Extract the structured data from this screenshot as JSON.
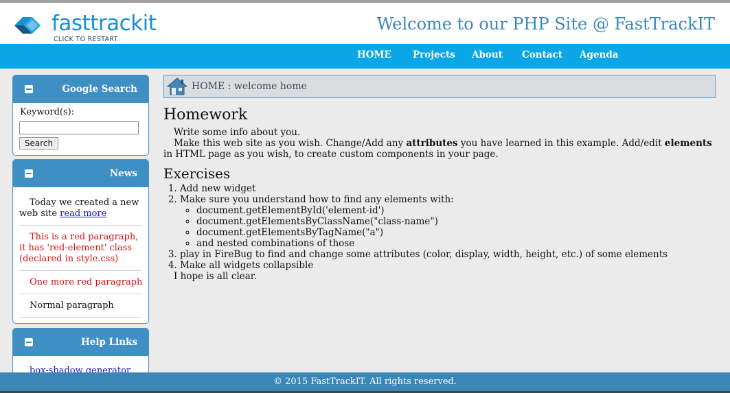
{
  "header": {
    "logo_text": "fasttrackit",
    "logo_subtext": "CLICK TO RESTART",
    "site_title": "Welcome to our PHP Site @ FastTrackIT"
  },
  "nav": {
    "items": [
      "HOME",
      "Projects",
      "About",
      "Contact",
      "Agenda"
    ]
  },
  "sidebar": {
    "search_widget": {
      "title": "Google Search",
      "keyword_label": "Keyword(s):",
      "input_value": "",
      "button_label": "Search"
    },
    "news_widget": {
      "title": "News",
      "item1_text": "Today we created a new web site ",
      "item1_link": "read more",
      "item2": "This is a red paragraph, it has 'red-element' class (declared in style.css)",
      "item3": "One more red paragraph",
      "item4": "Normal paragraph"
    },
    "help_widget": {
      "title": "Help Links",
      "item1": "box-shadow generator"
    }
  },
  "breadcrumb": {
    "text": "HOME : welcome home"
  },
  "main": {
    "heading": "Homework",
    "p1": "Write some info about you.",
    "p2_a": "Make this web site as you wish. Change/Add any ",
    "p2_b": "attributes",
    "p2_c": " you have learned in this example. Add/edit ",
    "p2_d": "elements",
    "p2_e": " in HTML page as you wish, to create custom components in your page.",
    "exercises_heading": "Exercises",
    "ex1": "Add new widget",
    "ex2": "Make sure you understand how to find any elements with:",
    "ex2_sub": [
      "document.getElementById('element-id')",
      "document.getElementsByClassName(\"class-name\")",
      "document.getElementsByTagName(\"a\")",
      "and nested combinations of those"
    ],
    "ex3": "play in FireBug to find and change some attributes (color, display, width, height, etc.) of some elements",
    "ex4": "Make all widgets collapsible",
    "closing": "I hope is all clear."
  },
  "footer": {
    "text": "© 2015 FastTrackIT. All rights reserved."
  },
  "colors": {
    "nav_bg": "#0aa6e6",
    "widget_header": "#3e8fc3",
    "footer_bg": "#3a86b7",
    "title_blue": "#3a88b9",
    "red_text": "#d41010"
  }
}
